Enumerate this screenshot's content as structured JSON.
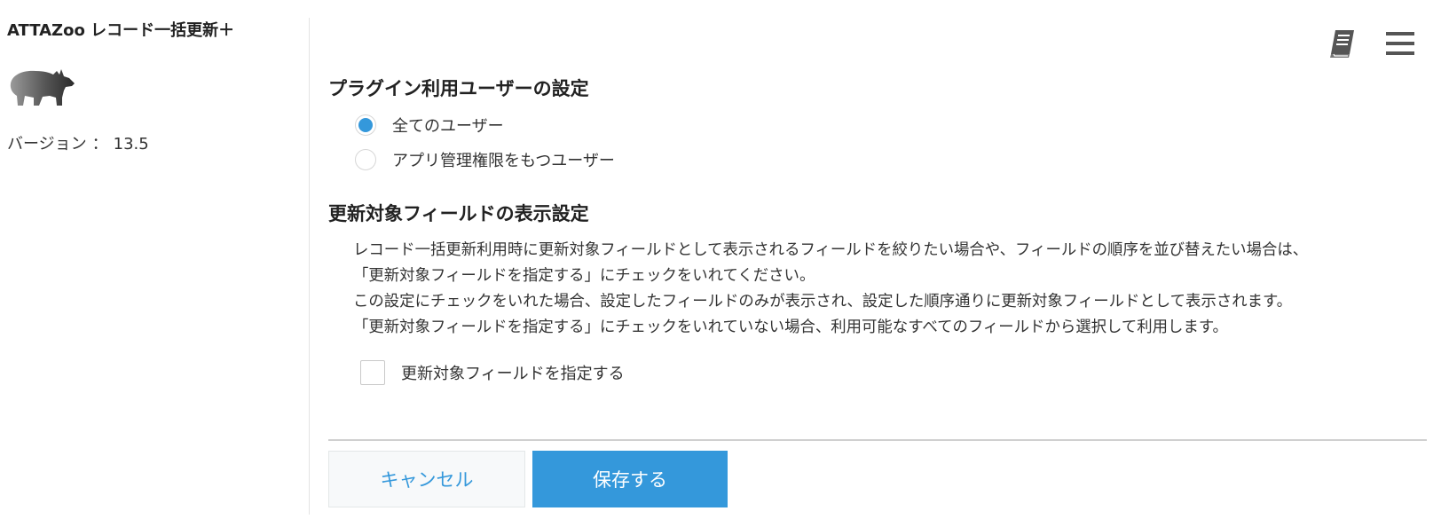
{
  "sidebar": {
    "plugin_title": "ATTAZoo レコード一括更新＋",
    "logo_icon": "rhino-icon",
    "version_label": "バージョン",
    "version_separator": "：",
    "version_value": "13.5"
  },
  "toolbar": {
    "manual_icon": "book-icon",
    "menu_icon": "hamburger-menu-icon"
  },
  "user_settings": {
    "title": "プラグイン利用ユーザーの設定",
    "options": [
      {
        "label": "全てのユーザー",
        "selected": true
      },
      {
        "label": "アプリ管理権限をもつユーザー",
        "selected": false
      }
    ]
  },
  "field_settings": {
    "title": "更新対象フィールドの表示設定",
    "description": [
      "レコード一括更新利用時に更新対象フィールドとして表示されるフィールドを絞りたい場合や、フィールドの順序を並び替えたい場合は、",
      "「更新対象フィールドを指定する」にチェックをいれてください。",
      "この設定にチェックをいれた場合、設定したフィールドのみが表示され、設定した順序通りに更新対象フィールドとして表示されます。",
      "「更新対象フィールドを指定する」にチェックをいれていない場合、利用可能なすべてのフィールドから選択して利用します。"
    ],
    "checkbox_label": "更新対象フィールドを指定する",
    "checkbox_checked": false
  },
  "buttons": {
    "cancel_label": "キャンセル",
    "save_label": "保存する"
  },
  "colors": {
    "accent": "#3498db",
    "text": "#333333",
    "divider": "#d0d0d0"
  }
}
